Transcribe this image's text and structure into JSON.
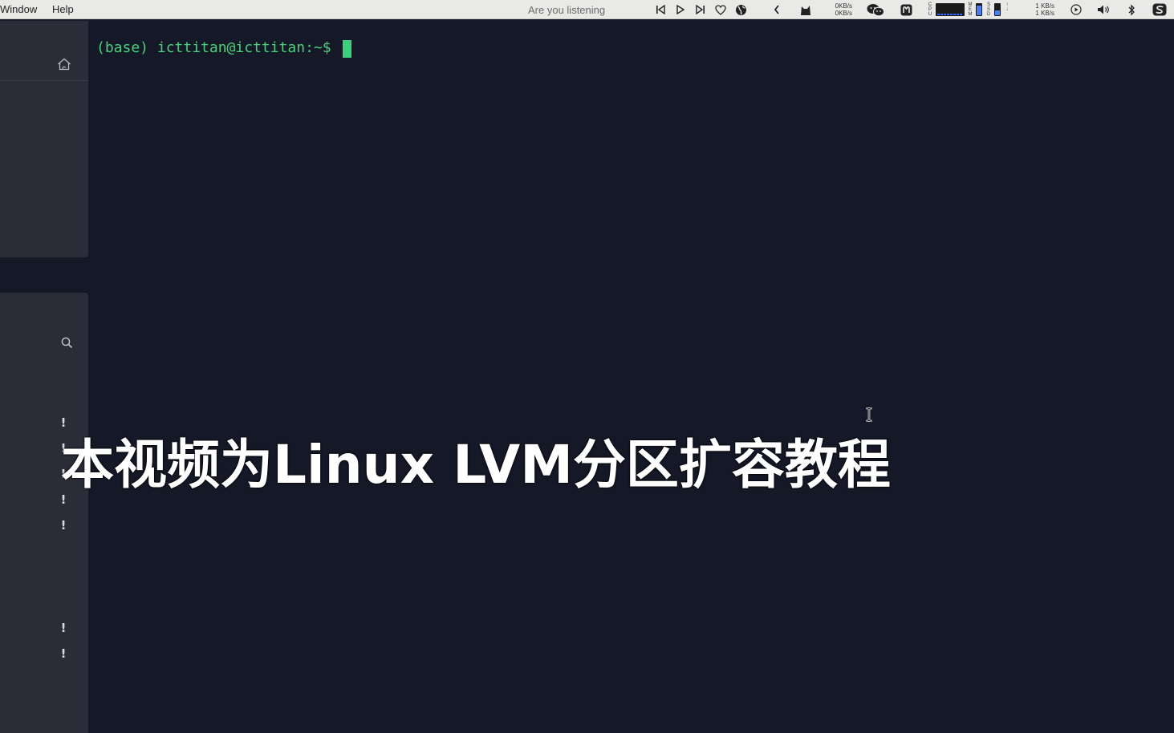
{
  "menubar": {
    "menu_items": [
      "Window",
      "Help"
    ],
    "now_playing": "Are you listening",
    "net_left": {
      "up": "0KB/s",
      "down": "0KB/s"
    },
    "cpu_label": "CPU",
    "mem_label": "MEM",
    "ssd_label": "SSD",
    "misc_label": "NET",
    "net_right": {
      "up": "1 KB/s",
      "down": "1 KB/s"
    },
    "icons": [
      "prev-track-icon",
      "play-icon",
      "next-track-icon",
      "heart-icon",
      "globe-icon",
      "chevron-left-icon",
      "cat-icon",
      "wechat-icon",
      "app-icon",
      "play-circle-icon",
      "volume-icon",
      "bluetooth-icon",
      "menu-app-icon"
    ]
  },
  "sidebar": {
    "top_icon": "home-icon",
    "search_icon": "search-icon",
    "alerts_group1": [
      "!",
      "!",
      "!",
      "!",
      "!"
    ],
    "alerts_group2": [
      "!",
      "!"
    ]
  },
  "terminal": {
    "prompt": "(base) icttitan@icttitan:~$",
    "background": "#151827",
    "prompt_color": "#45d27a"
  },
  "subtitle": "本视频为Linux LVM分区扩容教程"
}
